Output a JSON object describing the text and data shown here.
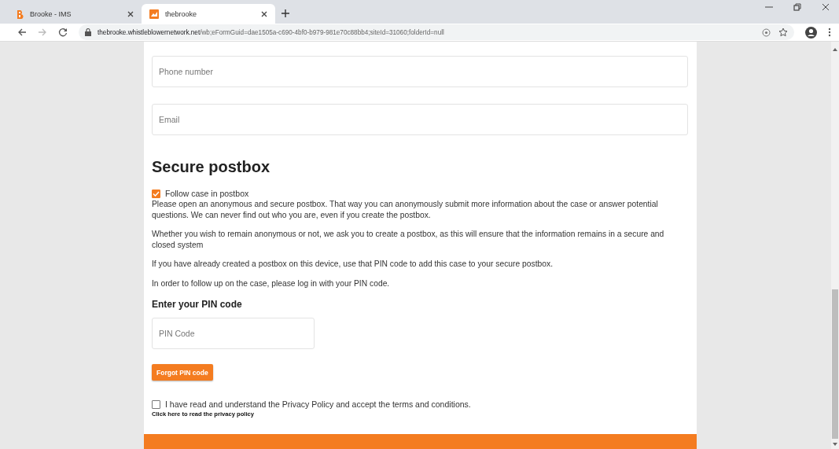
{
  "tabs": [
    {
      "title": "Brooke - IMS",
      "selected": false
    },
    {
      "title": "thebrooke",
      "selected": true
    }
  ],
  "address": {
    "host": "thebrooke.whistleblowernetwork.net",
    "path": "/wb;eFormGuid=dae1505a-c690-4bf0-b979-981e70c88bb4;siteId=31060;folderId=null"
  },
  "fields": [
    {
      "placeholder": "Phone number"
    },
    {
      "placeholder": "Email"
    }
  ],
  "heading": "Secure postbox",
  "follow": {
    "label": "Follow case in postbox",
    "checked": true
  },
  "paragraphs": [
    "Please open an anonymous and secure postbox. That way you can anonymously submit more information about the case or answer potential questions. We can never find out who you are, even if you create the postbox.",
    "Whether you wish to remain anonymous or not, we ask you to create a postbox, as this will ensure that the information remains in a secure and closed system",
    "If you have already created a postbox on this device, use that PIN code to add this case to your secure postbox.",
    "In order to follow up on the case, please log in with your PIN code."
  ],
  "pin": {
    "label": "Enter your PIN code",
    "placeholder": "PIN Code",
    "button": "Forgot PIN code"
  },
  "privacy": {
    "label": "I have read and understand the Privacy Policy and accept the terms and conditions.",
    "checked": false,
    "link": "Click here to read the privacy policy"
  }
}
